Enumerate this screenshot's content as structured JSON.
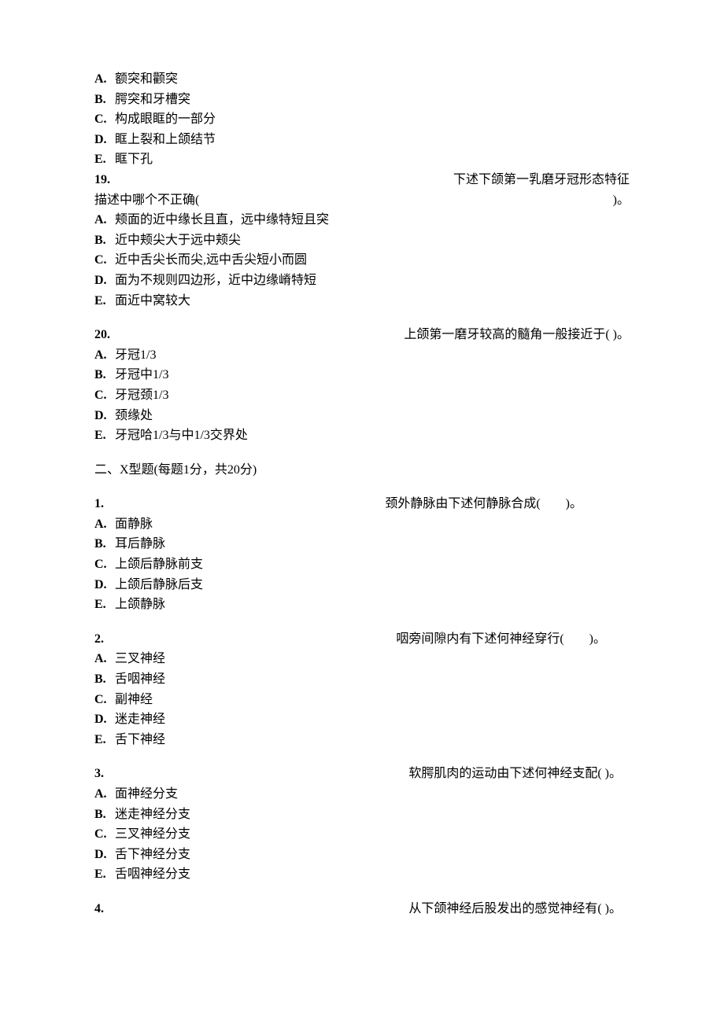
{
  "q18": {
    "options": {
      "A": {
        "letter": "A.",
        "text": "额突和颧突"
      },
      "B": {
        "letter": "B.",
        "text": "腭突和牙槽突"
      },
      "C": {
        "letter": "C.",
        "text": "构成眼眶的一部分"
      },
      "D": {
        "letter": "D.",
        "text": "眶上裂和上颌结节"
      },
      "E": {
        "letter": "E.",
        "text": "眶下孔"
      }
    }
  },
  "q19": {
    "number": "19.",
    "stem_right": "下述下颌第一乳磨牙冠形态特征",
    "stem_line2_left": "描述中哪个不正确(",
    "stem_line2_right": ")。",
    "options": {
      "A": {
        "letter": "A.",
        "text": "颊面的近中缘长且直，远中缘特短且突"
      },
      "B": {
        "letter": "B.",
        "text": "近中颊尖大于远中颊尖"
      },
      "C": {
        "letter": "C.",
        "text": "近中舌尖长而尖,远中舌尖短小而圆"
      },
      "D": {
        "letter": "D.",
        "text": "面为不规则四边形，近中边缘嵴特短"
      },
      "E": {
        "letter": "E.",
        "text": "面近中窝较大"
      }
    }
  },
  "q20": {
    "number": "20.",
    "stem_right": "上颌第一磨牙较高的髓角一般接近于(  )。",
    "options": {
      "A": {
        "letter": "A.",
        "text": "牙冠1/3"
      },
      "B": {
        "letter": "B.",
        "text": "牙冠中1/3"
      },
      "C": {
        "letter": "C.",
        "text": "牙冠颈1/3"
      },
      "D": {
        "letter": "D.",
        "text": "颈缘处"
      },
      "E": {
        "letter": "E.",
        "text": "牙冠哈1/3与中1/3交界处"
      }
    }
  },
  "section2_title": "二、X型题(每题1分，共20分)",
  "x1": {
    "number": "1.",
    "stem_right": "颈外静脉由下述何静脉合成(　　)。",
    "options": {
      "A": {
        "letter": "A.",
        "text": "面静脉"
      },
      "B": {
        "letter": "B.",
        "text": "耳后静脉"
      },
      "C": {
        "letter": "C.",
        "text": "上颌后静脉前支"
      },
      "D": {
        "letter": "D.",
        "text": "上颌后静脉后支"
      },
      "E": {
        "letter": "E.",
        "text": "上颌静脉"
      }
    }
  },
  "x2": {
    "number": "2.",
    "stem_right": "咽旁间隙内有下述何神经穿行(　　)。",
    "options": {
      "A": {
        "letter": "A.",
        "text": "三叉神经"
      },
      "B": {
        "letter": "B.",
        "text": "舌咽神经"
      },
      "C": {
        "letter": "C.",
        "text": "副神经"
      },
      "D": {
        "letter": "D.",
        "text": "迷走神经"
      },
      "E": {
        "letter": "E.",
        "text": "舌下神经"
      }
    }
  },
  "x3": {
    "number": "3.",
    "stem_right": "软腭肌肉的运动由下述何神经支配(  )。",
    "options": {
      "A": {
        "letter": "A.",
        "text": "面神经分支"
      },
      "B": {
        "letter": "B.",
        "text": "迷走神经分支"
      },
      "C": {
        "letter": "C.",
        "text": "三叉神经分支"
      },
      "D": {
        "letter": "D.",
        "text": "舌下神经分支"
      },
      "E": {
        "letter": "E.",
        "text": "舌咽神经分支"
      }
    }
  },
  "x4": {
    "number": "4.",
    "stem_right": "从下颌神经后股发出的感觉神经有(  )。"
  }
}
